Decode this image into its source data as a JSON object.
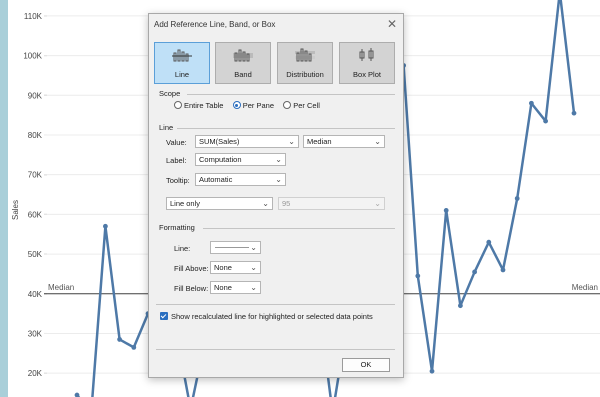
{
  "chart_data": {
    "type": "line",
    "y_axis_label": "Sales",
    "y_ticks": [
      "20K",
      "30K",
      "40K",
      "50K",
      "60K",
      "70K",
      "80K",
      "90K",
      "100K",
      "110K"
    ],
    "y_range": [
      14000,
      114000
    ],
    "reference_line": {
      "label": "Median",
      "value": 40000
    },
    "line_color": "#4e79a7",
    "series": [
      {
        "values": [
          14500,
          10000,
          57000,
          28500,
          26500,
          35000,
          34500,
          30000,
          11000,
          28000,
          30000,
          36000,
          32000,
          27000,
          30000,
          35000,
          33000,
          38000,
          10000,
          32000,
          73500,
          60000,
          79500,
          97500,
          44500,
          20500,
          61000,
          37000,
          45500,
          53000,
          46000,
          64000,
          88000,
          83500,
          116000,
          85500
        ]
      }
    ]
  },
  "dialog": {
    "title": "Add Reference Line, Band, or Box",
    "close_glyph": "✕",
    "types": [
      {
        "label": "Line",
        "icon": "line-chooser-icon",
        "selected": true
      },
      {
        "label": "Band",
        "icon": "band-chooser-icon",
        "selected": false
      },
      {
        "label": "Distribution",
        "icon": "distribution-chooser-icon",
        "selected": false
      },
      {
        "label": "Box Plot",
        "icon": "box-plot-chooser-icon",
        "selected": false
      }
    ],
    "scope": {
      "heading": "Scope",
      "options": [
        "Entire Table",
        "Per Pane",
        "Per Cell"
      ],
      "selected": "Per Pane"
    },
    "line": {
      "heading": "Line",
      "value_label": "Value:",
      "value": "SUM(Sales)",
      "aggregation": "Median",
      "label_label": "Label:",
      "label_value": "Computation",
      "tooltip_label": "Tooltip:",
      "tooltip_value": "Automatic",
      "mode": "Line only",
      "confidence": "95"
    },
    "formatting": {
      "heading": "Formatting",
      "line_label": "Line:",
      "fill_above_label": "Fill Above:",
      "fill_above": "None",
      "fill_below_label": "Fill Below:",
      "fill_below": "None"
    },
    "show_recalculated": {
      "label": "Show recalculated line for highlighted or selected data points",
      "checked": true
    },
    "ok_label": "OK"
  }
}
